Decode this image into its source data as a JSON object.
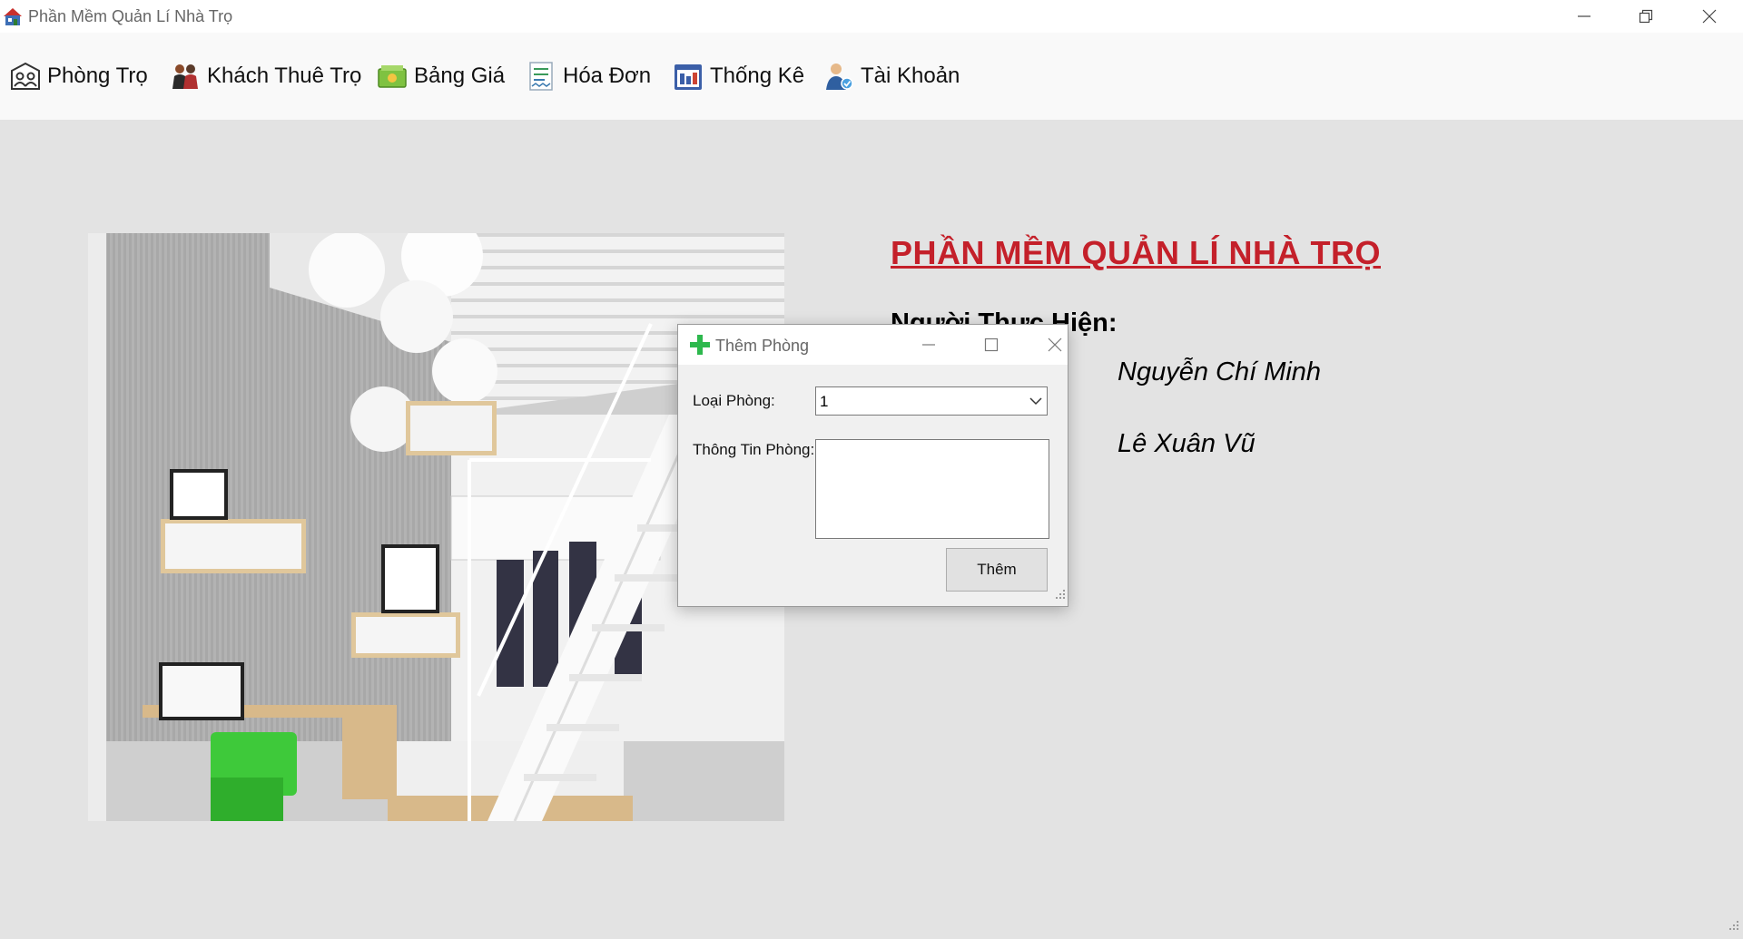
{
  "window": {
    "title": "Phần Mềm Quản Lí Nhà Trọ",
    "icon": "house-icon"
  },
  "menu": {
    "items": [
      {
        "label": "Phòng Trọ",
        "icon": "rooms-icon"
      },
      {
        "label": "Khách Thuê Trọ",
        "icon": "tenants-icon"
      },
      {
        "label": "Bảng Giá",
        "icon": "price-list-icon"
      },
      {
        "label": "Hóa Đơn",
        "icon": "invoice-icon"
      },
      {
        "label": "Thống Kê",
        "icon": "statistics-icon"
      },
      {
        "label": "Tài Khoản",
        "icon": "account-icon"
      }
    ]
  },
  "main": {
    "heading": "PHẦN MỀM QUẢN LÍ NHÀ TRỌ",
    "performers_label": "Người Thực Hiện:",
    "members": [
      "Nguyễn Chí Minh",
      "Lê Xuân Vũ"
    ]
  },
  "dialog": {
    "title": "Thêm Phòng",
    "icon": "plus-icon",
    "room_type_label": "Loại Phòng:",
    "room_type_value": "1",
    "room_info_label": "Thông Tin Phòng:",
    "room_info_value": "",
    "add_button": "Thêm"
  },
  "colors": {
    "heading": "#c4202a",
    "background": "#e3e3e3",
    "menubar": "#f9f9f9",
    "dialog_icon": "#2db84d"
  }
}
